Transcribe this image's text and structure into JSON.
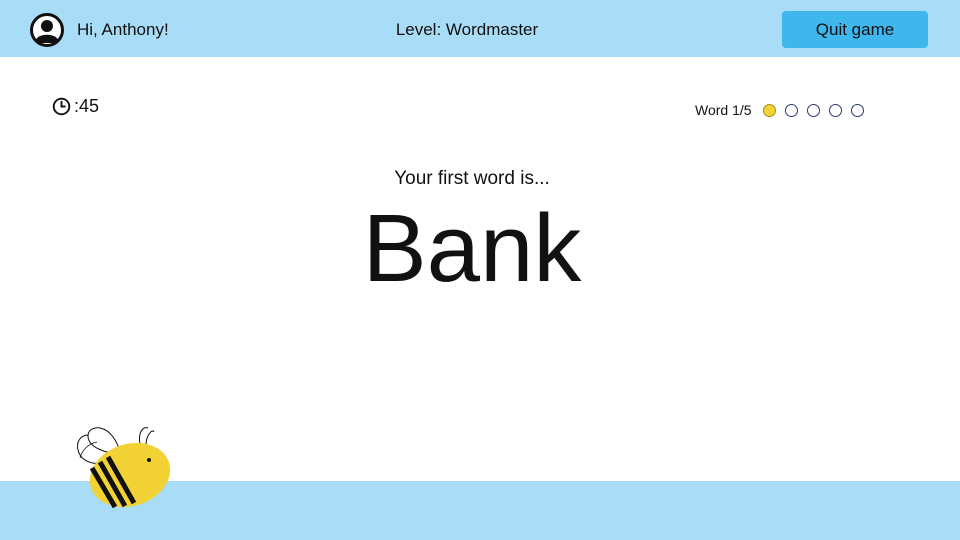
{
  "header": {
    "greeting": "Hi, Anthony!",
    "level": "Level: Wordmaster",
    "quit_label": "Quit game",
    "avatar_icon": "user-avatar-icon"
  },
  "timer": {
    "icon": "clock-icon",
    "value": ":45"
  },
  "progress": {
    "label": "Word 1/5",
    "current": 1,
    "total": 5,
    "filled_color": "#f2d234"
  },
  "main": {
    "prompt": "Your first word is...",
    "word": "Bank"
  },
  "mascot": {
    "icon": "bee-icon"
  },
  "colors": {
    "bar": "#a9dcf6",
    "button": "#3fb6ec",
    "accent": "#f2d234"
  }
}
